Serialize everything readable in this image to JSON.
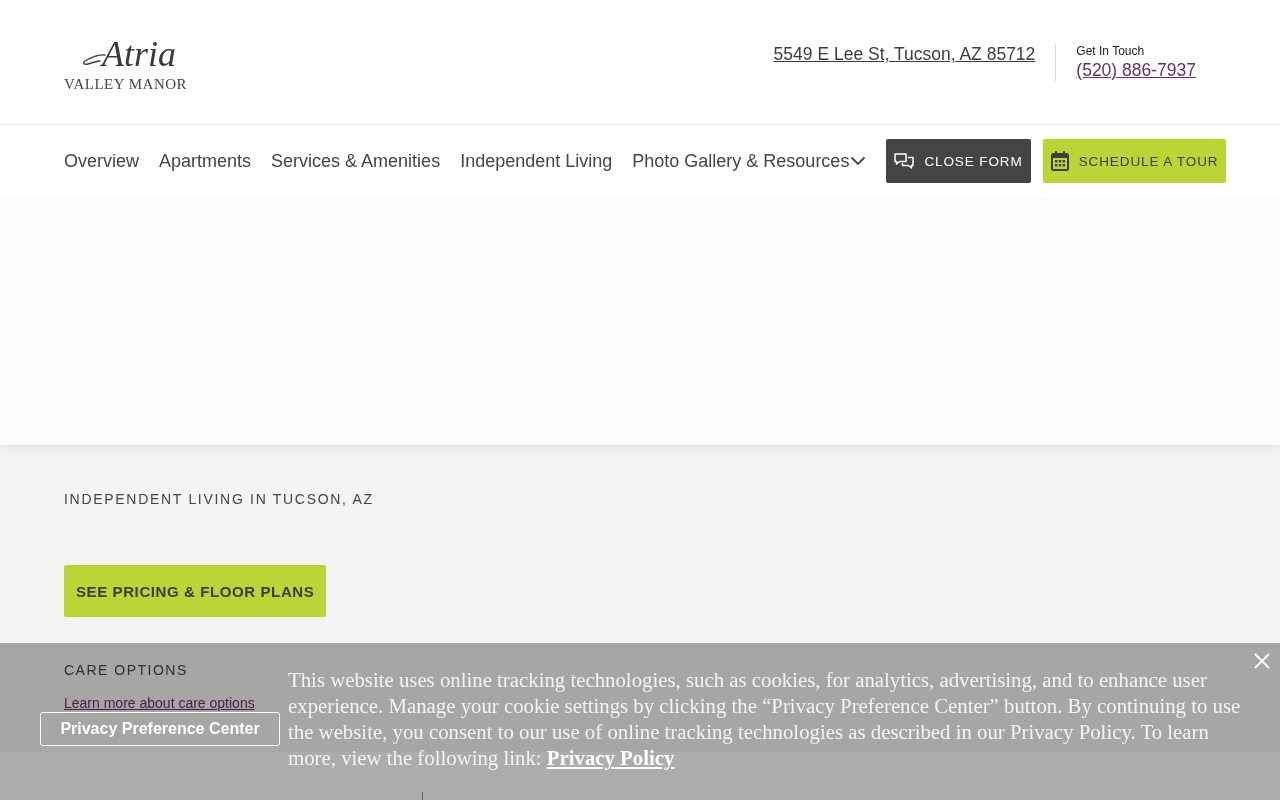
{
  "header": {
    "logo": {
      "script": "Atria",
      "name": "VALLEY MANOR"
    },
    "address": "5549 E Lee St, Tucson, AZ 85712",
    "contact": {
      "label": "Get In Touch",
      "phone": "(520) 886-7937"
    }
  },
  "nav": {
    "items": [
      {
        "label": "Overview",
        "dropdown": false
      },
      {
        "label": "Apartments",
        "dropdown": false
      },
      {
        "label": "Services & Amenities",
        "dropdown": false
      },
      {
        "label": "Independent Living",
        "dropdown": false
      },
      {
        "label": "Photo Gallery & Resources",
        "dropdown": true
      }
    ],
    "buttons": [
      {
        "label": "CLOSE FORM",
        "kind": "dark"
      },
      {
        "label": "SCHEDULE A TOUR",
        "kind": "accent"
      }
    ]
  },
  "intro": {
    "eyebrow": "INDEPENDENT LIVING IN TUCSON, AZ",
    "button": "SEE PRICING & FLOOR PLANS"
  },
  "care_options": {
    "heading": "CARE OPTIONS",
    "link": "Learn more about care options"
  },
  "cookie_banner": {
    "preference_button": "Privacy Preference Center",
    "message": "This website uses online tracking technologies, such as cookies, for analytics, advertising, and to enhance user experience. Manage your cookie settings by clicking the “Privacy Preference Center” button. By continuing to use the website, you consent to our use of online tracking technologies as described in our Privacy Policy. To learn more, view the following link:",
    "link": "Privacy Policy"
  }
}
